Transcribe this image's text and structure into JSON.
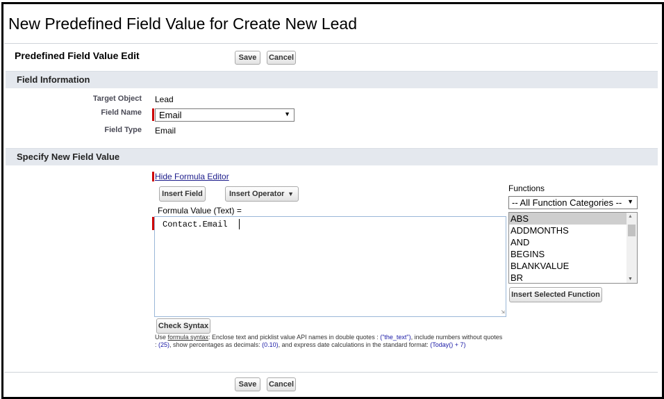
{
  "page": {
    "title": "New Predefined Field Value for Create New Lead"
  },
  "toolbar": {
    "edit_title": "Predefined Field Value Edit",
    "save_label": "Save",
    "cancel_label": "Cancel"
  },
  "field_info": {
    "section_title": "Field Information",
    "target_object_label": "Target Object",
    "target_object_value": "Lead",
    "field_name_label": "Field Name",
    "field_name_value": "Email",
    "field_type_label": "Field Type",
    "field_type_value": "Email"
  },
  "new_value": {
    "section_title": "Specify New Field Value",
    "hide_formula_link": "Hide Formula Editor",
    "insert_field_label": "Insert Field",
    "insert_operator_label": "Insert Operator",
    "formula_label": "Formula Value (Text) =",
    "formula_value": "Contact.Email",
    "check_syntax_label": "Check Syntax",
    "functions_label": "Functions",
    "function_category": "-- All Function Categories --",
    "functions": [
      "ABS",
      "ADDMONTHS",
      "AND",
      "BEGINS",
      "BLANKVALUE",
      "BR"
    ],
    "selected_function": "ABS",
    "insert_function_label": "Insert Selected Function",
    "help": {
      "use": "Use ",
      "syntax_link": "formula syntax",
      "p1": ": Enclose text and picklist value API names in double quotes : ",
      "ex1": "(\"the_text\")",
      "p2": ", include numbers without quotes : ",
      "ex2": "(25)",
      "p3": ", show percentages as decimals: ",
      "ex3": "(0.10)",
      "p4": ", and express date calculations in the standard format: ",
      "ex4": "(Today() + 7)"
    }
  }
}
